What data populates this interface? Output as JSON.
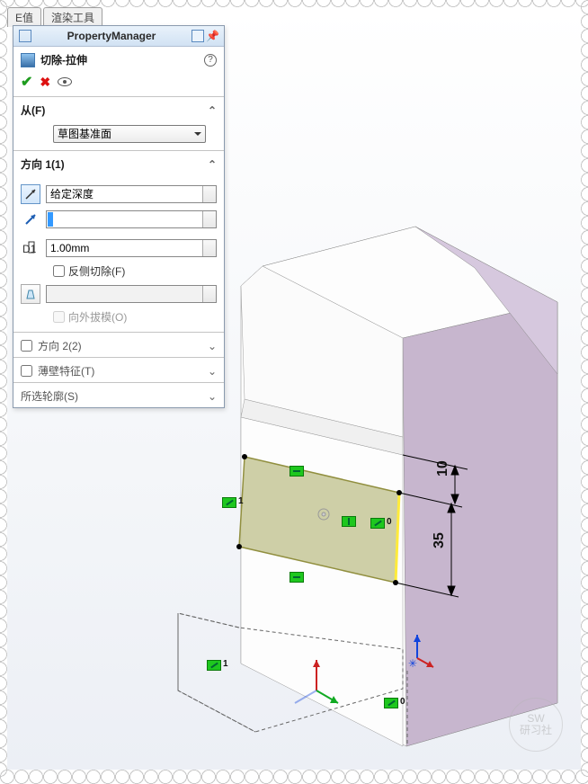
{
  "tabs": {
    "eval": "E值",
    "render": "渲染工具"
  },
  "pm": {
    "title": "PropertyManager",
    "feature_name": "切除-拉伸",
    "from": {
      "label": "从(F)",
      "value": "草图基准面"
    },
    "dir1": {
      "label": "方向 1(1)",
      "end_condition": "给定深度",
      "distance": "1.00mm",
      "flip_side": "反侧切除(F)",
      "draft_outward": "向外拔模(O)",
      "depth_value": ""
    },
    "dir2": {
      "label": "方向 2(2)"
    },
    "thin": {
      "label": "薄壁特征(T)"
    },
    "contours": {
      "label": "所选轮廓(S)"
    }
  },
  "dims": {
    "d10": "10",
    "d35": "35"
  },
  "rel_labels": {
    "one_a": "1",
    "zero_a": "0",
    "one_b": "1",
    "zero_b": "0"
  },
  "watermark": {
    "l1": "SW",
    "l2": "研习社"
  }
}
